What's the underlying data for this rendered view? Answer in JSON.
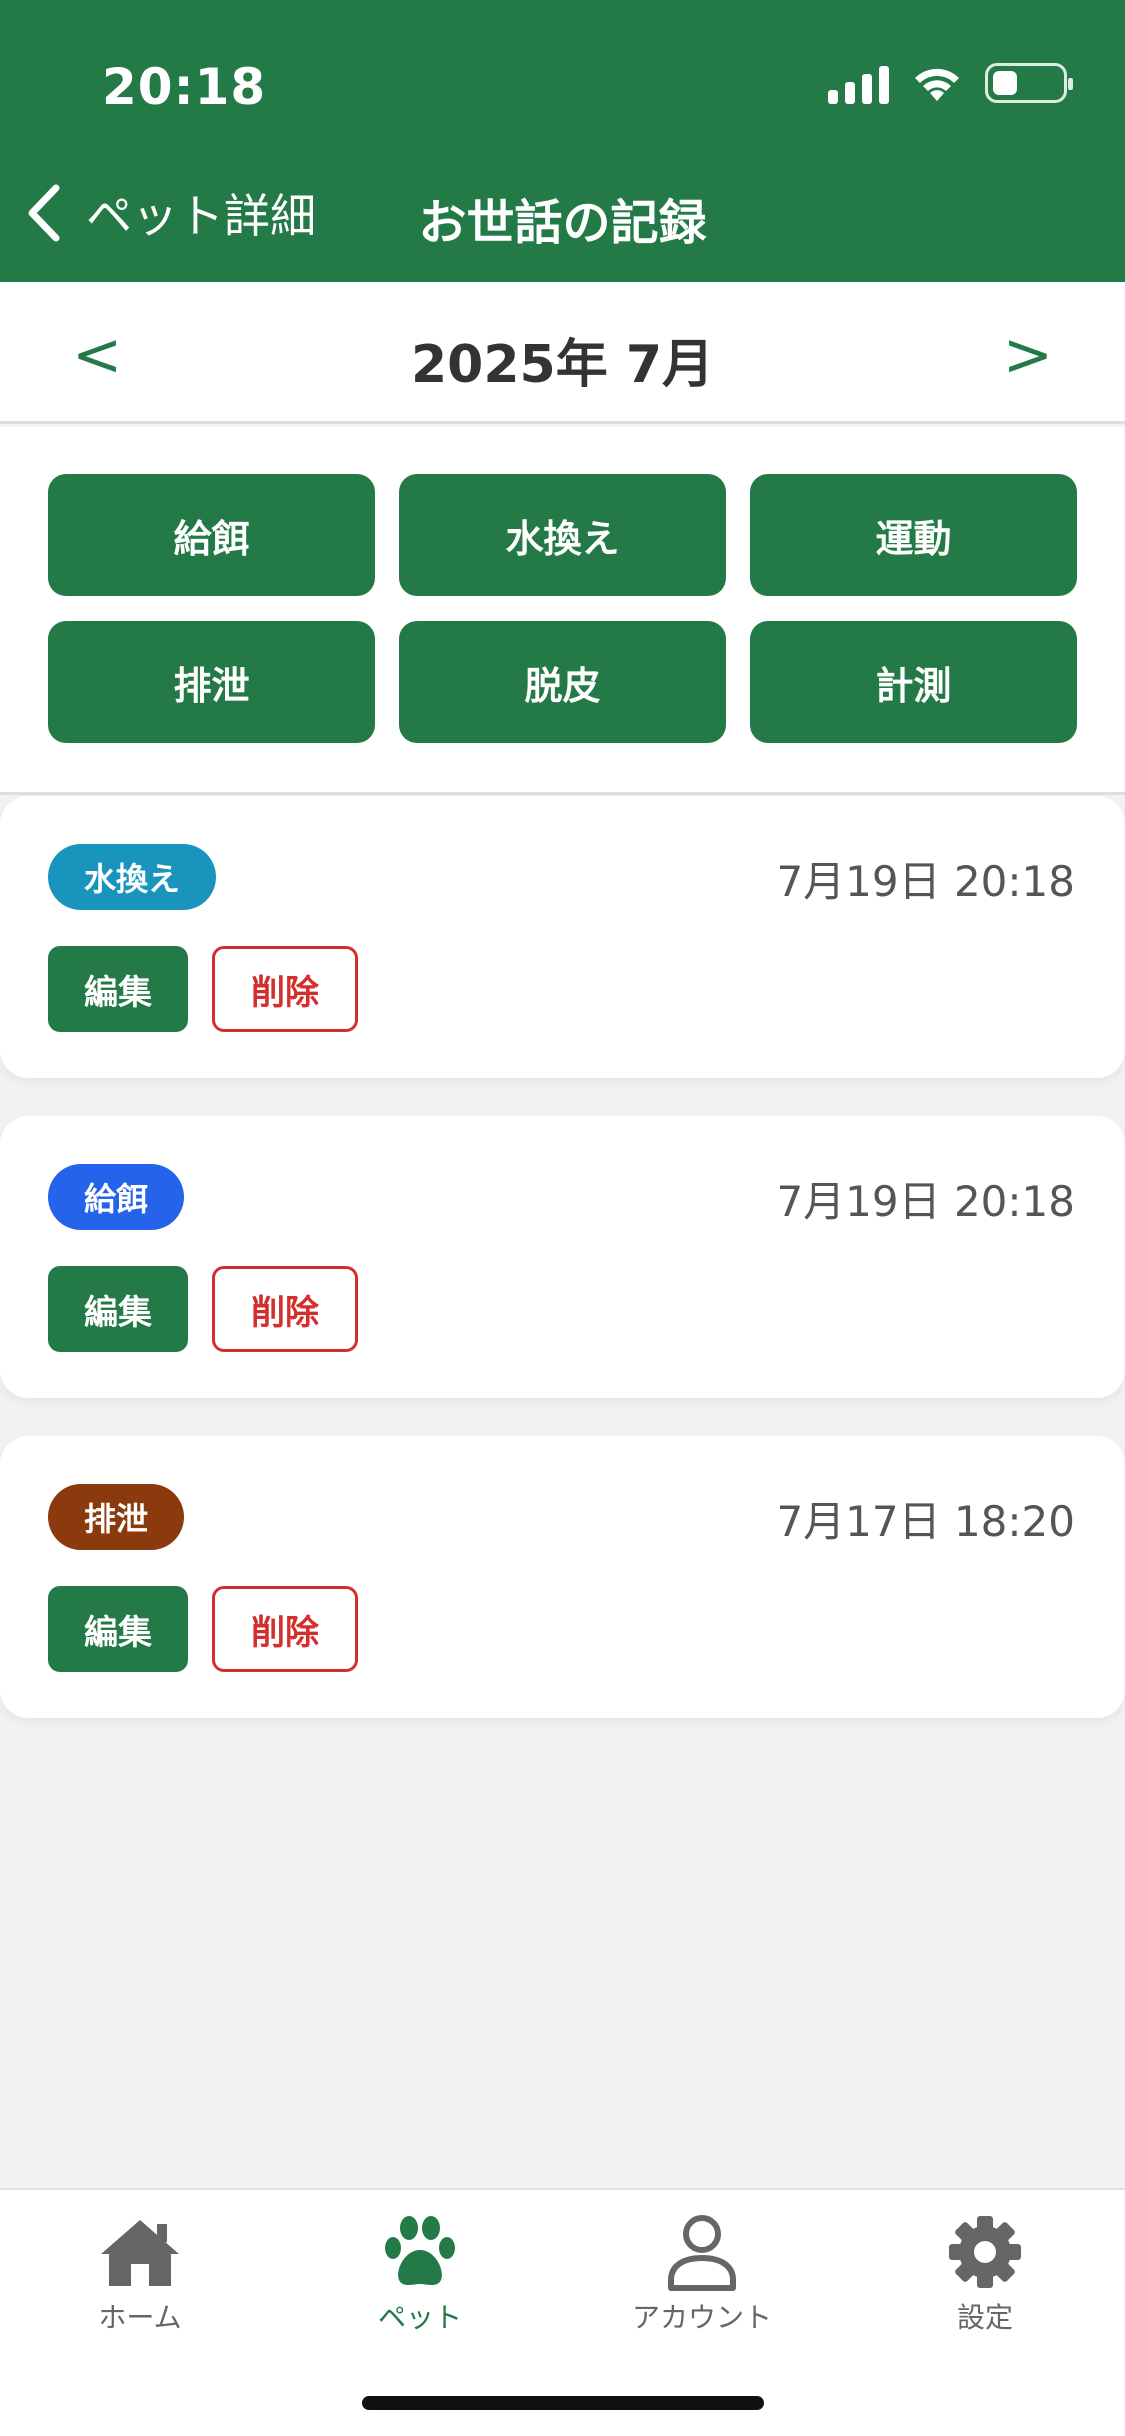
{
  "status": {
    "time": "20:18"
  },
  "nav": {
    "back_label": "ペット詳細",
    "title": "お世話の記録"
  },
  "month": {
    "label": "2025年 7月",
    "prev": "<",
    "next": ">"
  },
  "categories": [
    "給餌",
    "水換え",
    "運動",
    "排泄",
    "脱皮",
    "計測"
  ],
  "records": [
    {
      "tag": "水換え",
      "tag_color": "#1894bd",
      "date": "7月19日 20:18",
      "edit": "編集",
      "delete": "削除"
    },
    {
      "tag": "給餌",
      "tag_color": "#2563eb",
      "date": "7月19日 20:18",
      "edit": "編集",
      "delete": "削除"
    },
    {
      "tag": "排泄",
      "tag_color": "#8b3a0e",
      "date": "7月17日 18:20",
      "edit": "編集",
      "delete": "削除"
    }
  ],
  "tabs": [
    {
      "label": "ホーム",
      "icon": "home-icon",
      "active": false
    },
    {
      "label": "ペット",
      "icon": "paw-icon",
      "active": true
    },
    {
      "label": "アカウント",
      "icon": "user-icon",
      "active": false
    },
    {
      "label": "設定",
      "icon": "gear-icon",
      "active": false
    }
  ],
  "colors": {
    "primary": "#237a46",
    "danger": "#d32f2f"
  }
}
